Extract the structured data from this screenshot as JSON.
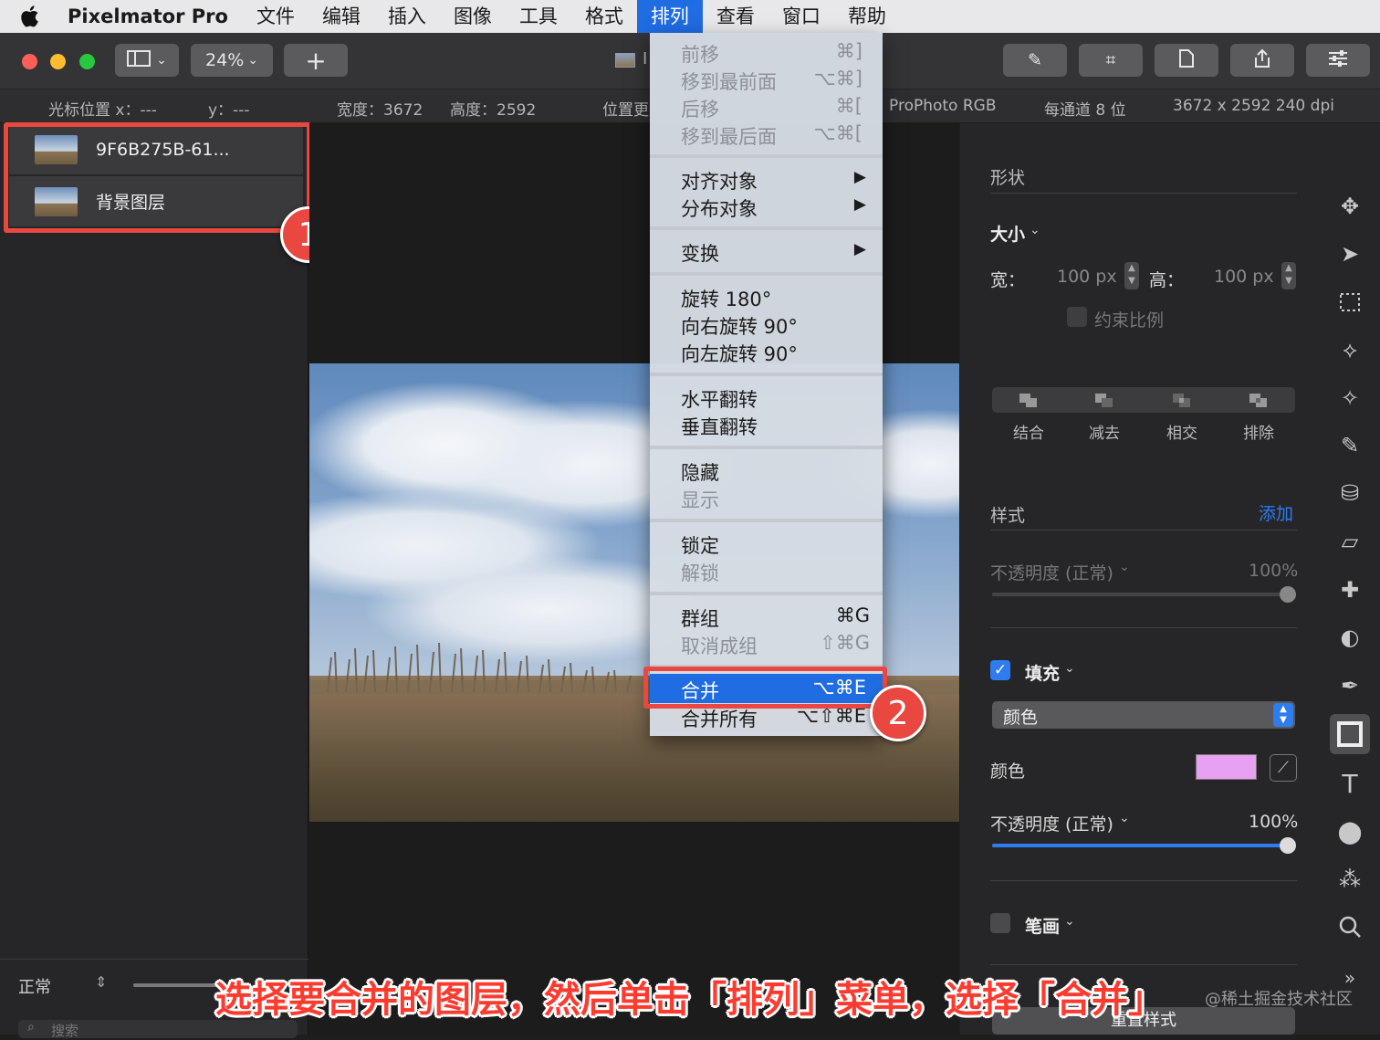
{
  "menubar": {
    "app": "Pixelmator Pro",
    "items": [
      "文件",
      "编辑",
      "插入",
      "图像",
      "工具",
      "格式",
      "排列",
      "查看",
      "窗口",
      "帮助"
    ],
    "active": "排列"
  },
  "toolbar": {
    "zoom": "24%"
  },
  "infobar": {
    "cursor_x": "光标位置 x：---",
    "cursor_y": "y：---",
    "width": "宽度：3672",
    "height": "高度：2592",
    "position": "位置更",
    "color_profile": "ProPhoto RGB",
    "bit_depth": "每通道 8 位",
    "dimensions": "3672 x 2592 240 dpi"
  },
  "layers": {
    "items": [
      {
        "name": "9F6B275B-61..."
      },
      {
        "name": "背景图层"
      }
    ],
    "blend_mode": "正常",
    "search_placeholder": "搜索"
  },
  "arrange_menu": {
    "items": [
      {
        "label": "前移",
        "shortcut": "⌘]",
        "enabled": false
      },
      {
        "label": "移到最前面",
        "shortcut": "⌥⌘]",
        "enabled": false
      },
      {
        "label": "后移",
        "shortcut": "⌘[",
        "enabled": false
      },
      {
        "label": "移到最后面",
        "shortcut": "⌥⌘[",
        "enabled": false
      },
      {
        "label": "对齐对象",
        "submenu": true,
        "enabled": true
      },
      {
        "label": "分布对象",
        "submenu": true,
        "enabled": true
      },
      {
        "label": "变换",
        "submenu": true,
        "enabled": true
      },
      {
        "label": "旋转 180°",
        "enabled": true
      },
      {
        "label": "向右旋转 90°",
        "enabled": true
      },
      {
        "label": "向左旋转 90°",
        "enabled": true
      },
      {
        "label": "水平翻转",
        "enabled": true
      },
      {
        "label": "垂直翻转",
        "enabled": true
      },
      {
        "label": "隐藏",
        "enabled": true
      },
      {
        "label": "显示",
        "enabled": false
      },
      {
        "label": "锁定",
        "enabled": true
      },
      {
        "label": "解锁",
        "enabled": false
      },
      {
        "label": "群组",
        "shortcut": "⌘G",
        "enabled": true
      },
      {
        "label": "取消成组",
        "shortcut": "⇧⌘G",
        "enabled": false
      },
      {
        "label": "合并",
        "shortcut": "⌥⌘E",
        "enabled": true,
        "highlighted": true
      },
      {
        "label": "合并所有",
        "shortcut": "⌥⇧⌘E",
        "enabled": true
      }
    ]
  },
  "panel": {
    "shape_title": "形状",
    "size_label": "大小",
    "width_label": "宽：",
    "width_value": "100 px",
    "height_label": "高：",
    "height_value": "100 px",
    "constrain": "约束比例",
    "boolean_ops": [
      "结合",
      "减去",
      "相交",
      "排除"
    ],
    "style_title": "样式",
    "add": "添加",
    "style_opacity_label": "不透明度 (正常)",
    "style_opacity_value": "100%",
    "fill_label": "填充",
    "fill_type": "颜色",
    "color_label": "颜色",
    "fill_color": "#e8a0f2",
    "fill_opacity_label": "不透明度 (正常)",
    "fill_opacity_value": "100%",
    "fill_opacity_fraction": 1.0,
    "stroke_label": "笔画",
    "reset": "重置样式"
  },
  "annotations": {
    "badge1": "1",
    "badge2": "2",
    "caption": "选择要合并的图层，然后单击「排列」菜单，选择「合并」",
    "watermark": "@稀土掘金技术社区"
  },
  "colors": {
    "accent": "#1f6ce3",
    "callout": "#e9473f",
    "traffic_red": "#ff5f57",
    "traffic_yellow": "#febc2e",
    "traffic_green": "#28c840"
  }
}
